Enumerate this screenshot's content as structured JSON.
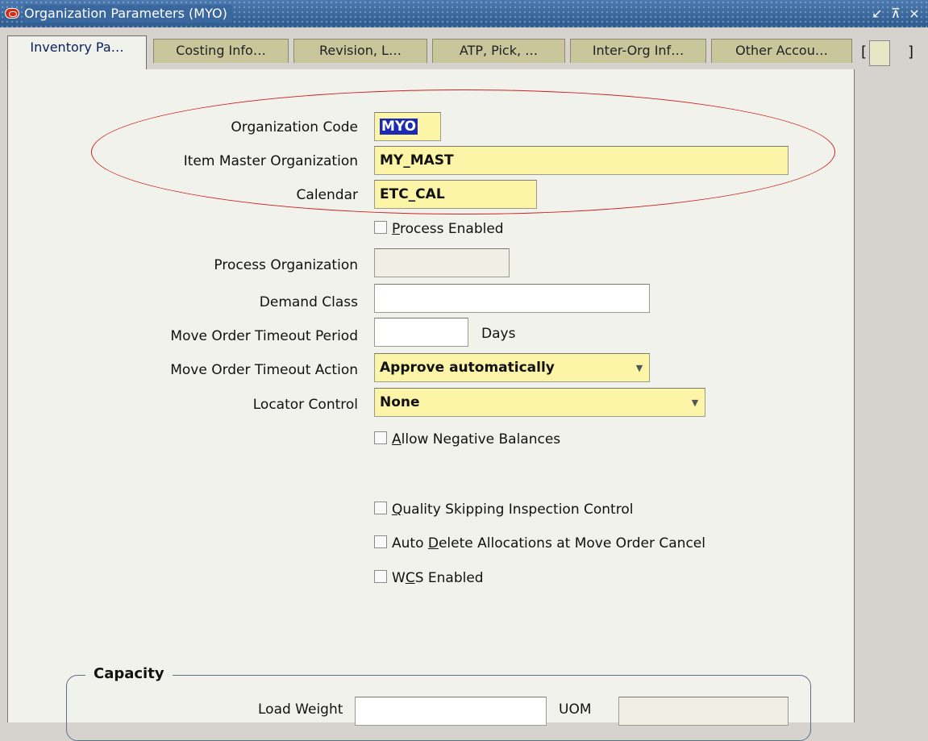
{
  "window": {
    "title": "Organization Parameters (MYO)",
    "controls": [
      "↙",
      "⊼",
      "×"
    ]
  },
  "tabs": [
    {
      "label": "Inventory Pa…",
      "active": true
    },
    {
      "label": "Costing Info…",
      "active": false
    },
    {
      "label": "Revision, L…",
      "active": false
    },
    {
      "label": "ATP, Pick, …",
      "active": false
    },
    {
      "label": "Inter-Org Inf…",
      "active": false
    },
    {
      "label": "Other Accou…",
      "active": false
    }
  ],
  "tab_overflow": {
    "left": "[",
    "right": "]"
  },
  "form": {
    "organization_code": {
      "label": "Organization Code",
      "value": "MYO"
    },
    "item_master_org": {
      "label": "Item Master Organization",
      "value": "MY_MAST"
    },
    "calendar": {
      "label": "Calendar",
      "value": "ETC_CAL"
    },
    "process_enabled": {
      "label": "Process Enabled",
      "mnemonic": "P",
      "rest": "rocess Enabled",
      "checked": false
    },
    "process_org": {
      "label": "Process Organization",
      "value": ""
    },
    "demand_class": {
      "label": "Demand Class",
      "value": ""
    },
    "move_order_timeout_period": {
      "label": "Move Order Timeout Period",
      "value": "",
      "unit": "Days"
    },
    "move_order_timeout_action": {
      "label": "Move Order Timeout Action",
      "value": "Approve automatically"
    },
    "locator_control": {
      "label": "Locator Control",
      "value": "None"
    },
    "allow_negative": {
      "label": "Allow Negative Balances",
      "mnemonic": "A",
      "rest": "llow Negative Balances",
      "checked": false
    },
    "quality_skipping": {
      "label": "Quality Skipping Inspection Control",
      "mnemonic": "Q",
      "rest": "uality Skipping Inspection Control",
      "checked": false
    },
    "auto_delete": {
      "label_pre": "Auto ",
      "mnemonic": "D",
      "rest": "elete Allocations at Move Order Cancel",
      "checked": false
    },
    "wcs_enabled": {
      "label_pre": "W",
      "mnemonic": "C",
      "rest": "S Enabled",
      "checked": false
    }
  },
  "capacity": {
    "title": "Capacity",
    "load_weight_label": "Load Weight",
    "uom_label": "UOM"
  },
  "colors": {
    "titlebar": "#3d6ba1",
    "required_field": "#fcf5a8",
    "highlight_circle": "#cc2222",
    "selection": "#1c2bb0"
  }
}
